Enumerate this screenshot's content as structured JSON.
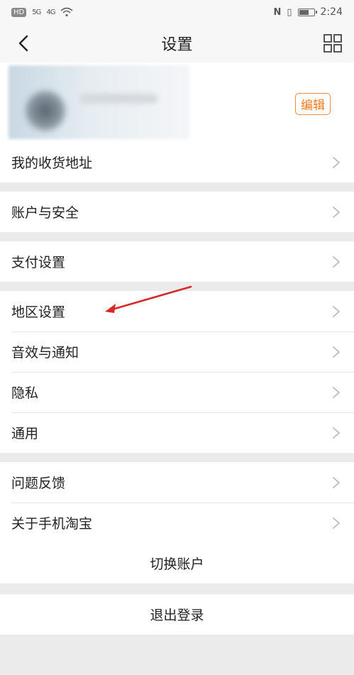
{
  "status_bar": {
    "left_badge": "HD",
    "signal1": "5G",
    "signal2": "4G",
    "time": "2:24",
    "battery_level": 0.7
  },
  "header": {
    "title": "设置"
  },
  "profile": {
    "edit_label": "编辑"
  },
  "groups": [
    [
      {
        "label": "我的收货地址"
      }
    ],
    [
      {
        "label": "账户与安全"
      }
    ],
    [
      {
        "label": "支付设置"
      }
    ],
    [
      {
        "label": "地区设置"
      },
      {
        "label": "音效与通知"
      },
      {
        "label": "隐私"
      },
      {
        "label": "通用"
      }
    ],
    [
      {
        "label": "问题反馈"
      },
      {
        "label": "关于手机淘宝"
      }
    ]
  ],
  "actions": {
    "switch_account": "切换账户",
    "logout": "退出登录"
  },
  "colors": {
    "accent": "#f07a1e",
    "annotation_arrow": "#d42a2a"
  }
}
